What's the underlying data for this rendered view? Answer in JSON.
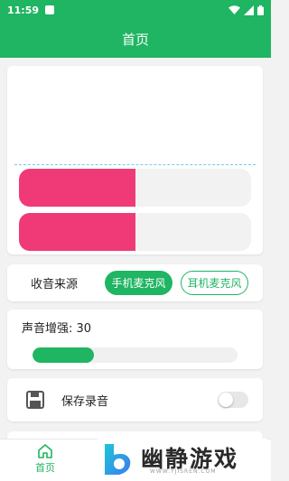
{
  "status_bar": {
    "time": "11:59"
  },
  "app_bar": {
    "title": "首页"
  },
  "levels": [
    {
      "fraction": 0.5
    },
    {
      "fraction": 0.5
    }
  ],
  "source": {
    "label": "收音来源",
    "options": [
      {
        "label": "手机麦克风",
        "selected": true
      },
      {
        "label": "耳机麦克风",
        "selected": false
      }
    ]
  },
  "boost": {
    "label": "声音增强: 30",
    "fraction": 0.3
  },
  "save": {
    "label": "保存录音",
    "enabled": false
  },
  "nav": {
    "home_label": "首页"
  },
  "watermark": {
    "text": "幽静游戏",
    "sub": "WWW.YJISREN.COM"
  },
  "colors": {
    "accent": "#1fb562",
    "level": "#f03a78"
  }
}
